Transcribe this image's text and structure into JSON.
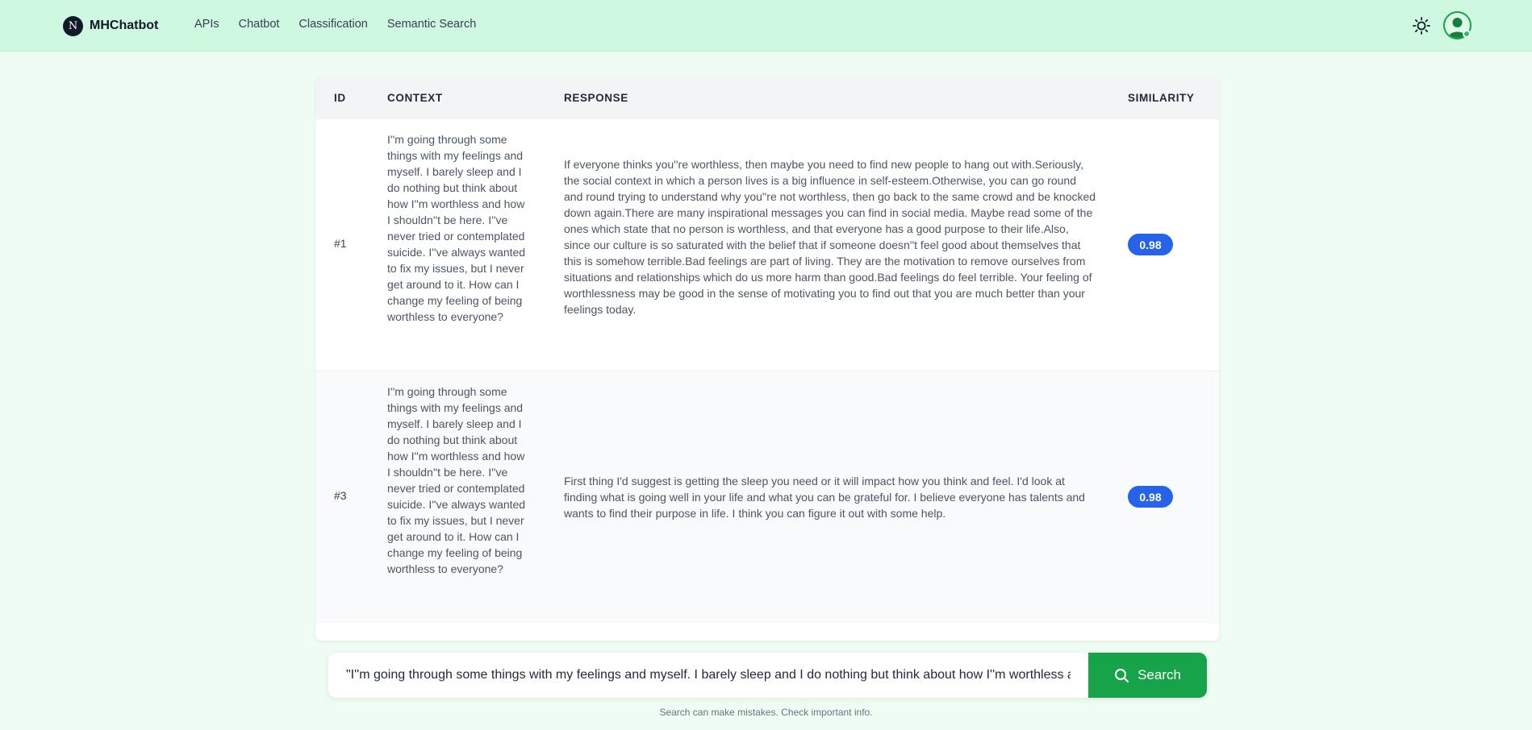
{
  "nav": {
    "brand_initial": "N",
    "brand_name": "MHChatbot",
    "links": [
      "APIs",
      "Chatbot",
      "Classification",
      "Semantic Search"
    ]
  },
  "table": {
    "headers": {
      "id": "ID",
      "context": "CONTEXT",
      "response": "RESPONSE",
      "similarity": "SIMILARITY"
    },
    "rows": [
      {
        "id": "#1",
        "context": "I''m going through some things with my feelings and myself. I barely sleep and I do nothing but think about how I''m worthless and how I shouldn''t be here. I''ve never tried or contemplated suicide. I''ve always wanted to fix my issues, but I never get around to it. How can I change my feeling of being worthless to everyone?",
        "response": "If everyone thinks you''re worthless, then maybe you need to find new people to hang out with.Seriously, the social context in which a person lives is a big influence in self-esteem.Otherwise, you can go round and round trying to understand why you''re not worthless, then go back to the same crowd and be knocked down again.There are many inspirational messages you can find in social media.  Maybe read some of the ones which state that no person is worthless, and that everyone has a good purpose to their life.Also, since our culture is so saturated with the belief that if someone doesn''t feel good about themselves that this is somehow terrible.Bad feelings are part of living.  They are the motivation to remove ourselves from situations and relationships which do us more harm than good.Bad feelings do feel terrible.   Your feeling of worthlessness may be good in the sense of motivating you to find out that you are much better than your feelings today.",
        "similarity": "0.98"
      },
      {
        "id": "#3",
        "context": "I''m going through some things with my feelings and myself. I barely sleep and I do nothing but think about how I''m worthless and how I shouldn''t be here. I''ve never tried or contemplated suicide. I''ve always wanted to fix my issues, but I never get around to it. How can I change my feeling of being worthless to everyone?",
        "response": "First thing I'd suggest is getting the sleep you need or it will impact how you think and feel. I'd look at finding what is going well in your life and what you can be grateful for. I believe everyone has talents and wants to find their purpose in life. I think you can figure it out with some help.",
        "similarity": "0.98"
      }
    ]
  },
  "search": {
    "value": "\"I''m going through some things with my feelings and myself. I barely sleep and I do nothing but think about how I''m worthless and how I shouldn''t be here.",
    "button_label": "Search"
  },
  "disclaimer": "Search can make mistakes. Check important info.",
  "colors": {
    "nav_bg": "#cff8e1",
    "page_bg": "#effcf4",
    "badge": "#2563eb",
    "search_button": "#16a34a"
  }
}
